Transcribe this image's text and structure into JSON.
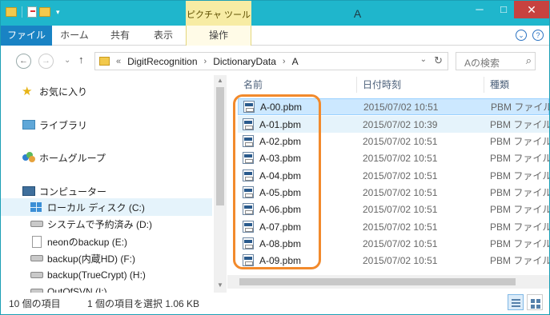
{
  "title": {
    "window_title": "A",
    "context_tab": "ピクチャ ツール",
    "minimize": "─",
    "maximize": "□",
    "close": "✕",
    "qat_dropdown": "▾"
  },
  "ribbon": {
    "tabs": [
      "ファイル",
      "ホーム",
      "共有",
      "表示",
      "操作"
    ],
    "collapse_glyph": "⌄",
    "help_glyph": "?"
  },
  "nav": {
    "back": "←",
    "forward": "→",
    "recent": "⌄",
    "up": "↑",
    "breadcrumbs": [
      "«",
      "DigitRecognition",
      "DictionaryData",
      "A"
    ],
    "separator": "›",
    "dropdown": "⌄",
    "refresh": "↻",
    "search_placeholder": "Aの検索",
    "search_glyph": "⌕"
  },
  "sidebar": {
    "items": [
      {
        "label": "お気に入り",
        "icon": "star-icon"
      },
      {
        "label": "ライブラリ",
        "icon": "library-icon"
      },
      {
        "label": "ホームグループ",
        "icon": "homegroup-icon"
      },
      {
        "label": "コンピューター",
        "icon": "computer-icon"
      },
      {
        "label": "ローカル ディスク (C:)",
        "icon": "windows-drive-icon"
      },
      {
        "label": "システムで予約済み (D:)",
        "icon": "drive-icon"
      },
      {
        "label": "neonのbackup (E:)",
        "icon": "blank-drive-icon"
      },
      {
        "label": "backup(内蔵HD) (F:)",
        "icon": "drive-icon"
      },
      {
        "label": "backup(TrueCrypt) (H:)",
        "icon": "drive-icon"
      },
      {
        "label": "OutOfSVN (I:)",
        "icon": "drive-icon"
      }
    ]
  },
  "list": {
    "columns": [
      "名前",
      "日付時刻",
      "種類"
    ],
    "sort_glyph": "^",
    "rows": [
      {
        "name": "A-00.pbm",
        "date": "2015/07/02 10:51",
        "type": "PBM ファイル"
      },
      {
        "name": "A-01.pbm",
        "date": "2015/07/02 10:39",
        "type": "PBM ファイル"
      },
      {
        "name": "A-02.pbm",
        "date": "2015/07/02 10:51",
        "type": "PBM ファイル"
      },
      {
        "name": "A-03.pbm",
        "date": "2015/07/02 10:51",
        "type": "PBM ファイル"
      },
      {
        "name": "A-04.pbm",
        "date": "2015/07/02 10:51",
        "type": "PBM ファイル"
      },
      {
        "name": "A-05.pbm",
        "date": "2015/07/02 10:51",
        "type": "PBM ファイル"
      },
      {
        "name": "A-06.pbm",
        "date": "2015/07/02 10:51",
        "type": "PBM ファイル"
      },
      {
        "name": "A-07.pbm",
        "date": "2015/07/02 10:51",
        "type": "PBM ファイル"
      },
      {
        "name": "A-08.pbm",
        "date": "2015/07/02 10:51",
        "type": "PBM ファイル"
      },
      {
        "name": "A-09.pbm",
        "date": "2015/07/02 10:51",
        "type": "PBM ファイル"
      }
    ]
  },
  "status": {
    "item_count": "10 個の項目",
    "selection": "1 個の項目を選択  1.06 KB"
  },
  "colors": {
    "titlebar": "#1fb6cc",
    "file_tab": "#1983c4",
    "context_tab": "#f7eca4",
    "selection": "#cce8ff",
    "highlight_box": "#f28a2c",
    "close_button": "#c7423f"
  }
}
